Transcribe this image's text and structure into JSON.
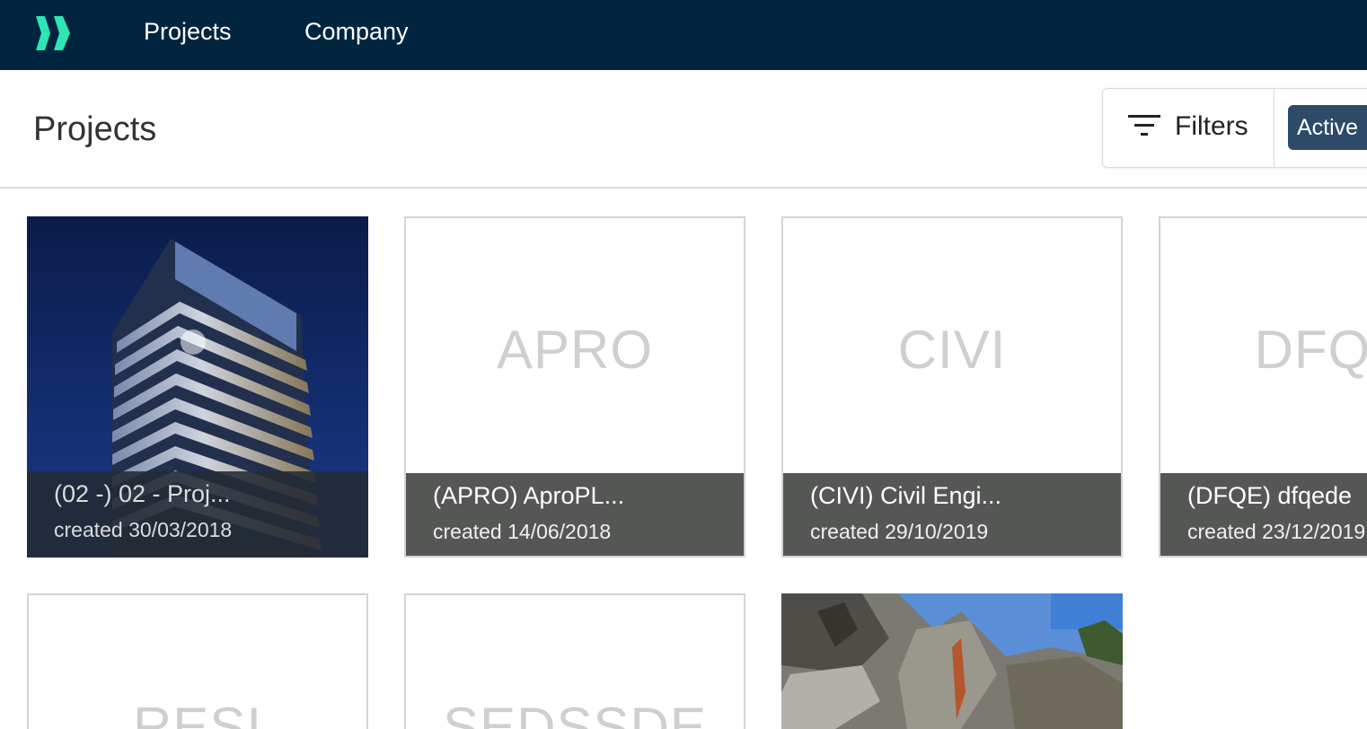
{
  "nav": {
    "logo_icon": "double-chevron-logo",
    "links": [
      "Projects",
      "Company"
    ]
  },
  "header": {
    "title": "Projects",
    "filters_label": "Filters",
    "filter_icon": "filter-lines-icon",
    "status_chip": "Active"
  },
  "colors": {
    "topbar": "#02253f",
    "logo": "#2ee6b4",
    "chip": "#2d4a68",
    "caption": "#555755"
  },
  "projects": [
    {
      "code": "",
      "name": "(02 -) 02 - Proj...",
      "created": "created 30/03/2018",
      "has_image": true
    },
    {
      "code": "APRO",
      "name": "(APRO) AproPL...",
      "created": "created 14/06/2018",
      "has_image": false
    },
    {
      "code": "CIVI",
      "name": "(CIVI) Civil Engi...",
      "created": "created 29/10/2019",
      "has_image": false
    },
    {
      "code": "DFQE",
      "name": "(DFQE) dfqede",
      "created": "created 23/12/2019",
      "has_image": false
    },
    {
      "code": "RESI",
      "name": "",
      "created": "",
      "has_image": false
    },
    {
      "code": "SEDSSDE",
      "name": "",
      "created": "",
      "has_image": false
    },
    {
      "code": "",
      "name": "",
      "created": "",
      "has_image": true
    }
  ]
}
